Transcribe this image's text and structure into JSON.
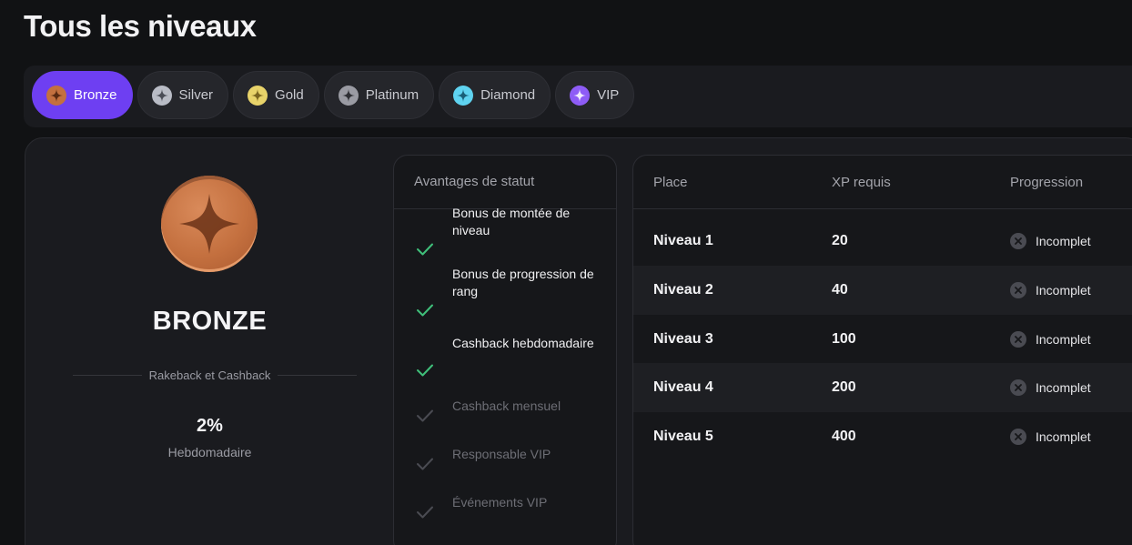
{
  "page_title": "Tous les niveaux",
  "tiers": [
    {
      "label": "Bronze",
      "color": "#c4703f",
      "star": "#5a2a12",
      "active": true
    },
    {
      "label": "Silver",
      "color": "#b9bcc6",
      "star": "#4a4d57",
      "active": false
    },
    {
      "label": "Gold",
      "color": "#e8d36a",
      "star": "#7a6520",
      "active": false
    },
    {
      "label": "Platinum",
      "color": "#9a9ba3",
      "star": "#2e2f34",
      "active": false
    },
    {
      "label": "Diamond",
      "color": "#5fd3f0",
      "star": "#1a5f78",
      "active": false
    },
    {
      "label": "VIP",
      "color": "#8e5cf6",
      "star": "#f1eaff",
      "active": false
    }
  ],
  "rank": {
    "name": "BRONZE",
    "perk_caption": "Rakeback et Cashback",
    "perk_value": "2%",
    "perk_period": "Hebdomadaire"
  },
  "benefits": {
    "header": "Avantages de statut",
    "items": [
      {
        "label": "Bonus de montée de niveau",
        "enabled": true
      },
      {
        "label": "Bonus de progression de rang",
        "enabled": true
      },
      {
        "label": "Cashback hebdomadaire",
        "enabled": true
      },
      {
        "label": "Cashback mensuel",
        "enabled": false
      },
      {
        "label": "Responsable VIP",
        "enabled": false
      },
      {
        "label": "Événements VIP",
        "enabled": false
      }
    ]
  },
  "levels": {
    "headers": {
      "place": "Place",
      "xp": "XP requis",
      "progress": "Progression"
    },
    "rows": [
      {
        "place": "Niveau 1",
        "xp": "20",
        "status": "Incomplet"
      },
      {
        "place": "Niveau 2",
        "xp": "40",
        "status": "Incomplet"
      },
      {
        "place": "Niveau 3",
        "xp": "100",
        "status": "Incomplet"
      },
      {
        "place": "Niveau 4",
        "xp": "200",
        "status": "Incomplet"
      },
      {
        "place": "Niveau 5",
        "xp": "400",
        "status": "Incomplet"
      }
    ]
  },
  "colors": {
    "accent": "#6e3ff2",
    "check_on": "#3fbf7a",
    "check_off": "#4a4b52"
  }
}
